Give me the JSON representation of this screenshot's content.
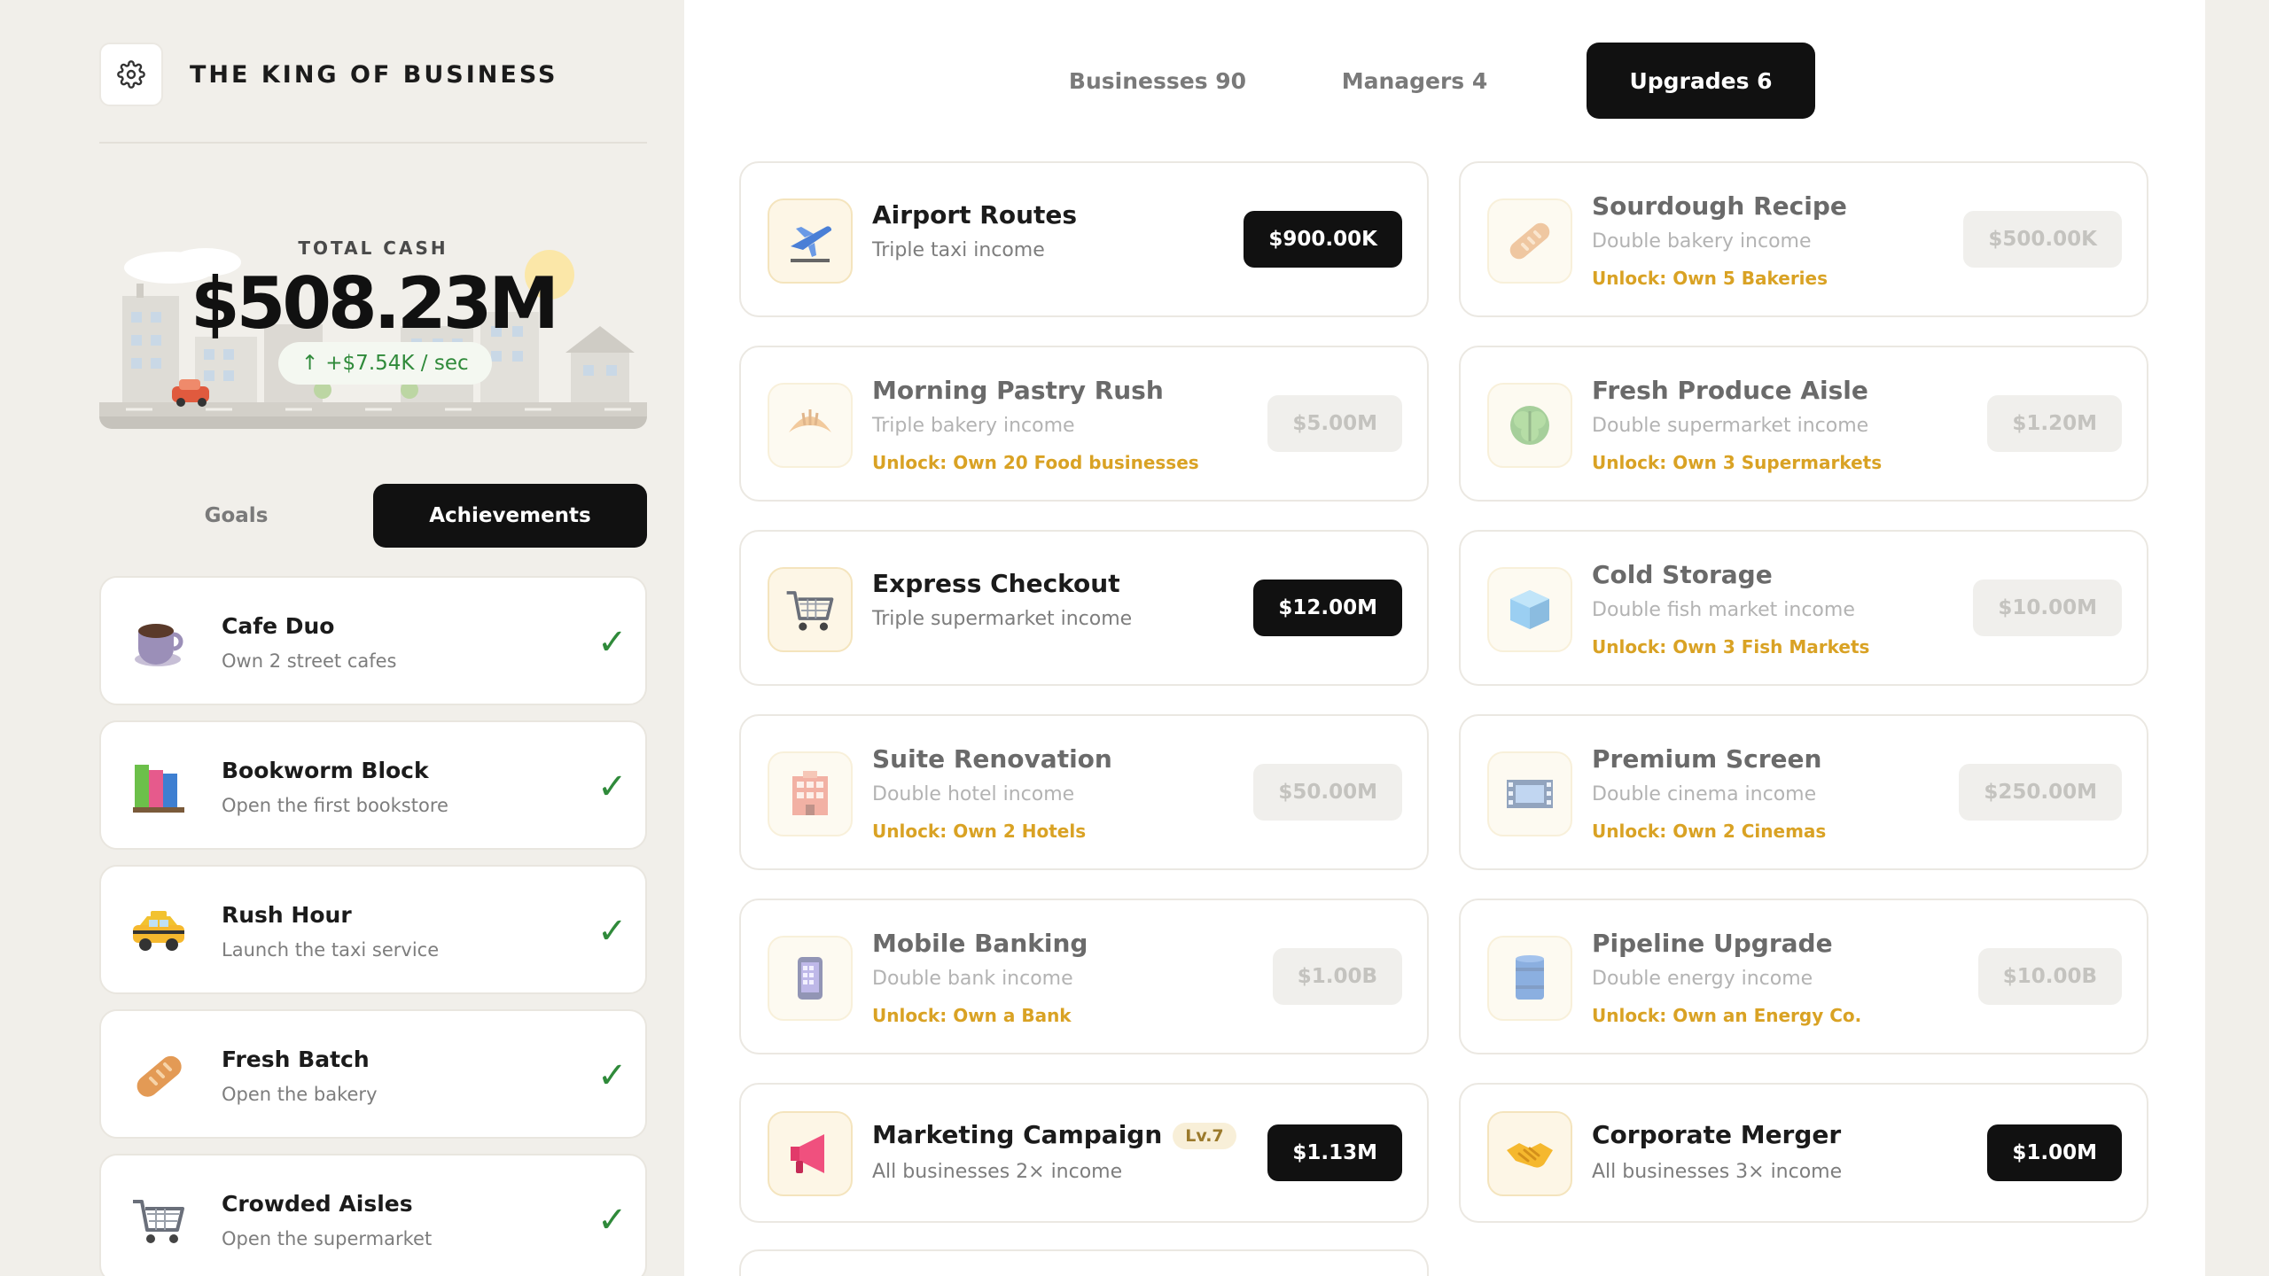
{
  "app": {
    "title": "THE KING OF BUSINESS"
  },
  "cash": {
    "label": "TOTAL CASH",
    "value": "$508.23M",
    "rate_arrow": "↑",
    "rate": "+$7.54K / sec"
  },
  "sidebar_tabs": [
    {
      "label": "Goals",
      "active": false
    },
    {
      "label": "Achievements",
      "active": true
    }
  ],
  "achievements": [
    {
      "title": "Cafe Duo",
      "desc": "Own 2 street cafes",
      "icon": "coffee-cup-icon",
      "done": true,
      "check": "✓"
    },
    {
      "title": "Bookworm Block",
      "desc": "Open the first bookstore",
      "icon": "books-icon",
      "done": true,
      "check": "✓"
    },
    {
      "title": "Rush Hour",
      "desc": "Launch the taxi service",
      "icon": "taxi-icon",
      "done": true,
      "check": "✓"
    },
    {
      "title": "Fresh Batch",
      "desc": "Open the bakery",
      "icon": "bread-icon",
      "done": true,
      "check": "✓"
    },
    {
      "title": "Crowded Aisles",
      "desc": "Open the supermarket",
      "icon": "shopping-cart-icon",
      "done": true,
      "check": "✓"
    }
  ],
  "main_tabs": [
    {
      "label": "Businesses 90",
      "active": false
    },
    {
      "label": "Managers 4",
      "active": false
    },
    {
      "label": "Upgrades 6",
      "active": true
    }
  ],
  "upgrades": [
    {
      "name": "Airport Routes",
      "desc": "Triple taxi income",
      "unlock": "",
      "price": "$900.00K",
      "state": "buy",
      "icon": "airplane-icon",
      "level": ""
    },
    {
      "name": "Sourdough Recipe",
      "desc": "Double bakery income",
      "unlock": "Unlock: Own 5 Bakeries",
      "price": "$500.00K",
      "state": "locked",
      "icon": "bread-icon",
      "level": ""
    },
    {
      "name": "Morning Pastry Rush",
      "desc": "Triple bakery income",
      "unlock": "Unlock: Own 20 Food businesses",
      "price": "$5.00M",
      "state": "locked",
      "icon": "croissant-icon",
      "level": ""
    },
    {
      "name": "Fresh Produce Aisle",
      "desc": "Double supermarket income",
      "unlock": "Unlock: Own 3 Supermarkets",
      "price": "$1.20M",
      "state": "locked",
      "icon": "lettuce-icon",
      "level": ""
    },
    {
      "name": "Express Checkout",
      "desc": "Triple supermarket income",
      "unlock": "",
      "price": "$12.00M",
      "state": "buy",
      "icon": "shopping-cart-icon",
      "level": ""
    },
    {
      "name": "Cold Storage",
      "desc": "Double fish market income",
      "unlock": "Unlock: Own 3 Fish Markets",
      "price": "$10.00M",
      "state": "locked",
      "icon": "ice-cube-icon",
      "level": ""
    },
    {
      "name": "Suite Renovation",
      "desc": "Double hotel income",
      "unlock": "Unlock: Own 2 Hotels",
      "price": "$50.00M",
      "state": "locked",
      "icon": "hotel-icon",
      "level": ""
    },
    {
      "name": "Premium Screen",
      "desc": "Double cinema income",
      "unlock": "Unlock: Own 2 Cinemas",
      "price": "$250.00M",
      "state": "locked",
      "icon": "film-icon",
      "level": ""
    },
    {
      "name": "Mobile Banking",
      "desc": "Double bank income",
      "unlock": "Unlock: Own a Bank",
      "price": "$1.00B",
      "state": "locked",
      "icon": "mobile-phone-icon",
      "level": ""
    },
    {
      "name": "Pipeline Upgrade",
      "desc": "Double energy income",
      "unlock": "Unlock: Own an Energy Co.",
      "price": "$10.00B",
      "state": "locked",
      "icon": "oil-drum-icon",
      "level": ""
    },
    {
      "name": "Marketing Campaign",
      "desc": "All businesses 2× income",
      "unlock": "",
      "price": "$1.13M",
      "state": "buy",
      "icon": "megaphone-icon",
      "level": "Lv.7"
    },
    {
      "name": "Corporate Merger",
      "desc": "All businesses 3× income",
      "unlock": "",
      "price": "$1.00M",
      "state": "buy",
      "icon": "handshake-icon",
      "level": ""
    }
  ],
  "colors": {
    "accent_dark": "#111111",
    "success": "#2f8a3a",
    "unlock_gold": "#d9a224",
    "sidebar_bg": "#f1efea"
  }
}
